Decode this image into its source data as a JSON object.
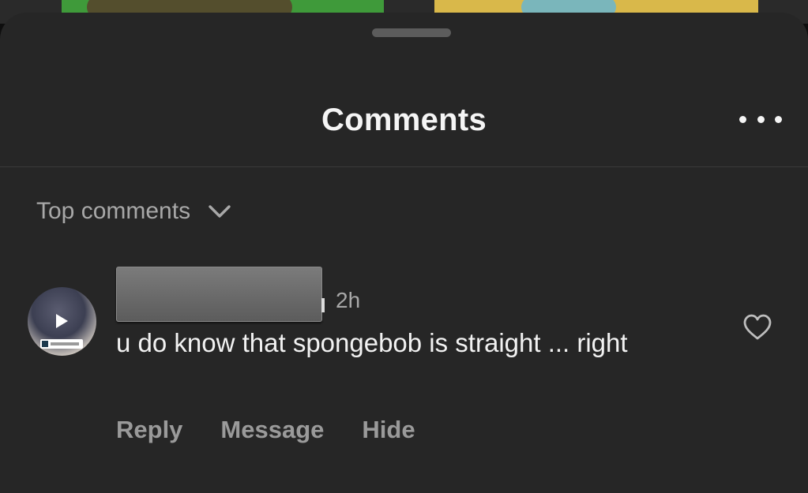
{
  "header": {
    "title": "Comments",
    "more_icon": "ellipsis-icon"
  },
  "sort": {
    "label": "Top comments",
    "icon": "chevron-down-icon"
  },
  "comment": {
    "time": "2h",
    "text": "u do know that spongebob is straight ... right",
    "like_icon": "heart-outline-icon",
    "actions": {
      "reply": "Reply",
      "message": "Message",
      "hide": "Hide"
    }
  },
  "colors": {
    "sheet_background": "#262626",
    "primary_text": "#f5f5f5",
    "secondary_text": "#a8a8a8"
  }
}
